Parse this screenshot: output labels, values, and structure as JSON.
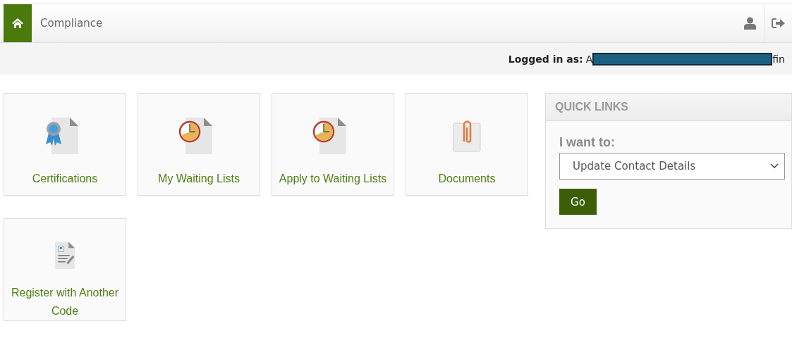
{
  "navbar": {
    "title": "Compliance"
  },
  "user_bar": {
    "label": "Logged in as:",
    "name_start": "A",
    "name_end": "fin"
  },
  "tiles": [
    {
      "label": "Certifications",
      "kind": "certificate"
    },
    {
      "label": "My Waiting Lists",
      "kind": "clock"
    },
    {
      "label": "Apply to Waiting Lists",
      "kind": "clock"
    },
    {
      "label": "Documents",
      "kind": "paperclip"
    },
    {
      "label": "Register with Another Code",
      "kind": "form"
    }
  ],
  "quick_links": {
    "title": "QUICK LINKS",
    "prompt": "I want to:",
    "select_value": "Update Contact Details",
    "button": "Go"
  }
}
